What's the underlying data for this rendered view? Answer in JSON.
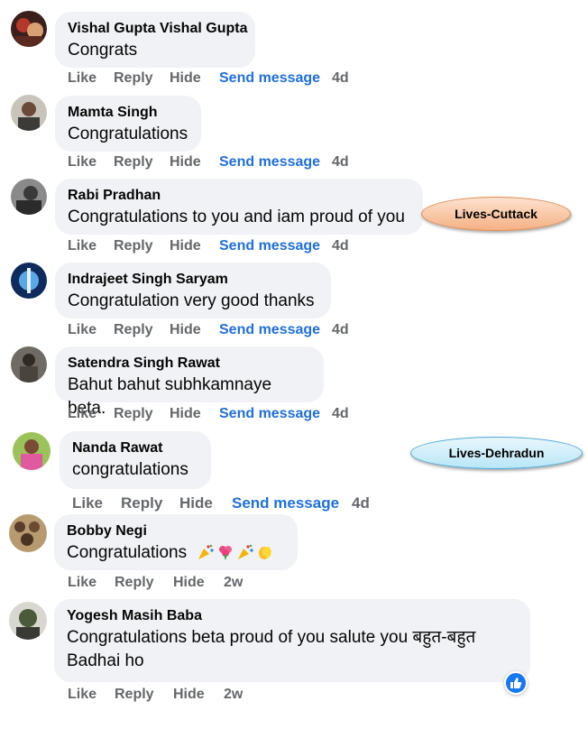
{
  "comments": [
    {
      "author": "Vishal Gupta Vishal Gupta",
      "text": "Congrats",
      "actions": {
        "like": "Like",
        "reply": "Reply",
        "hide": "Hide",
        "send": "Send message",
        "time": "4d"
      }
    },
    {
      "author": "Mamta Singh",
      "text": "Congratulations",
      "actions": {
        "like": "Like",
        "reply": "Reply",
        "hide": "Hide",
        "send": "Send message",
        "time": "4d"
      }
    },
    {
      "author": "Rabi Pradhan",
      "text": "Congratulations to you and iam proud of you",
      "actions": {
        "like": "Like",
        "reply": "Reply",
        "hide": "Hide",
        "send": "Send message",
        "time": "4d"
      }
    },
    {
      "author": "Indrajeet Singh Saryam",
      "text": "Congratulation very good thanks",
      "actions": {
        "like": "Like",
        "reply": "Reply",
        "hide": "Hide",
        "send": "Send message",
        "time": "4d"
      }
    },
    {
      "author": "Satendra Singh Rawat",
      "text": "Bahut bahut subhkamnaye beta.",
      "actions": {
        "like": "Like",
        "reply": "Reply",
        "hide": "Hide",
        "send": "Send message",
        "time": "4d"
      }
    },
    {
      "author": "Nanda Rawat",
      "text": "congratulations",
      "actions": {
        "like": "Like",
        "reply": "Reply",
        "hide": "Hide",
        "send": "Send message",
        "time": "4d"
      }
    },
    {
      "author": "Bobby Negi",
      "text": "Congratulations",
      "emojis": [
        "party-popper",
        "flower-bouquet",
        "party-popper",
        "clapping-hands"
      ],
      "actions": {
        "like": "Like",
        "reply": "Reply",
        "hide": "Hide",
        "time": "2w"
      }
    },
    {
      "author": "Yogesh Masih Baba",
      "text": "Congratulations beta proud of you salute you बहुत-बहुत Badhai ho",
      "actions": {
        "like": "Like",
        "reply": "Reply",
        "hide": "Hide",
        "time": "2w"
      }
    }
  ],
  "callouts": {
    "cuttack": "Lives-Cuttack",
    "dehradun": "Lives-Dehradun"
  },
  "reaction_badge": {
    "icon": "thumbs-up-icon",
    "color": "#1877f2"
  },
  "colors": {
    "bubble": "#f0f2f5",
    "link": "#216fdb",
    "meta": "#65676b"
  }
}
